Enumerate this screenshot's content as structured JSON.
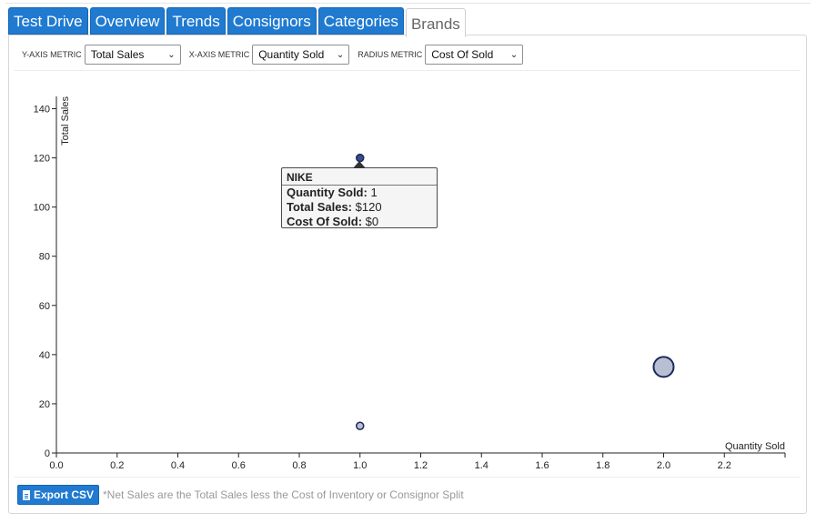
{
  "tabs": [
    {
      "label": "Test Drive",
      "active": false
    },
    {
      "label": "Overview",
      "active": false
    },
    {
      "label": "Trends",
      "active": false
    },
    {
      "label": "Consignors",
      "active": false
    },
    {
      "label": "Categories",
      "active": false
    },
    {
      "label": "Brands",
      "active": true
    }
  ],
  "controls": {
    "y_label": "Y-AXIS METRIC",
    "y_value": "Total Sales",
    "x_label": "X-AXIS METRIC",
    "x_value": "Quantity Sold",
    "r_label": "RADIUS METRIC",
    "r_value": "Cost Of Sold"
  },
  "tooltip": {
    "title": "NIKE",
    "row1_label": "Quantity Sold:",
    "row1_value": "1",
    "row2_label": "Total Sales:",
    "row2_value": "$120",
    "row3_label": "Cost Of Sold:",
    "row3_value": "$0"
  },
  "footer": {
    "export_label": "Export CSV",
    "note": "*Net Sales are the Total Sales less the Cost of Inventory or Consignor Split"
  },
  "colors": {
    "tab_blue": "#1f7ad0",
    "point_fill": "#b8bfd3",
    "point_stroke": "#1c2a5a",
    "highlight_fill": "#3a4c8a"
  },
  "chart_data": {
    "type": "scatter",
    "xlabel": "Quantity Sold",
    "ylabel": "Total Sales",
    "xlim": [
      0,
      2.4
    ],
    "ylim": [
      0,
      145
    ],
    "x_ticks": [
      "0.0",
      "0.2",
      "0.4",
      "0.6",
      "0.8",
      "1.0",
      "1.2",
      "1.4",
      "1.6",
      "1.8",
      "2.0",
      "2.2"
    ],
    "y_ticks": [
      "0",
      "20",
      "40",
      "60",
      "80",
      "100",
      "120",
      "140"
    ],
    "points": [
      {
        "x": 1,
        "y": 120,
        "r_value": 0,
        "highlighted": true
      },
      {
        "x": 1,
        "y": 11,
        "r_value": 0,
        "highlighted": false
      },
      {
        "x": 2,
        "y": 35,
        "r_value": 1,
        "highlighted": false
      }
    ]
  }
}
